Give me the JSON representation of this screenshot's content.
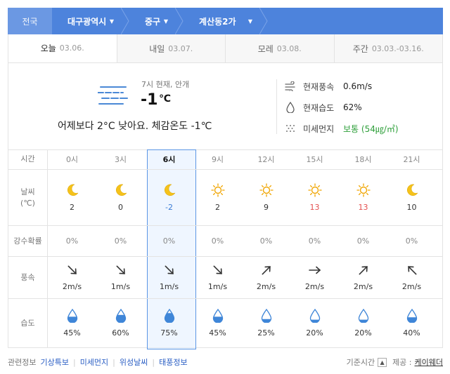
{
  "breadcrumb": {
    "root": "전국",
    "city": "대구광역시",
    "district": "중구",
    "dong": "계산동2가"
  },
  "tabs": [
    {
      "label": "오늘",
      "date": "03.06."
    },
    {
      "label": "내일",
      "date": "03.07."
    },
    {
      "label": "모레",
      "date": "03.08."
    },
    {
      "label": "주간",
      "date": "03.03.-03.16."
    }
  ],
  "current": {
    "status": "7시 현재, 안개",
    "temp": "-1",
    "unit": "℃",
    "compare": "어제보다 2°C 낮아요.   체감온도 -1℃",
    "icon": "fog-icon",
    "wind_label": "현재풍속",
    "wind_value": "0.6m/s",
    "humidity_label": "현재습도",
    "humidity_value": "62%",
    "dust_label": "미세먼지",
    "dust_value": "보통 (54㎍/㎥)"
  },
  "table": {
    "row_labels": {
      "time": "시간",
      "weather": "날씨\n(℃)",
      "precip": "강수확률",
      "wind": "풍속",
      "humidity": "습도"
    },
    "hours": [
      "0시",
      "3시",
      "6시",
      "9시",
      "12시",
      "15시",
      "18시",
      "21시"
    ],
    "current_index": 2,
    "weather": [
      "moon",
      "moon",
      "moon",
      "sun",
      "sun",
      "sun",
      "sun",
      "moon"
    ],
    "temps": [
      "2",
      "0",
      "-2",
      "2",
      "9",
      "13",
      "13",
      "10"
    ],
    "precip": [
      "0%",
      "0%",
      "0%",
      "0%",
      "0%",
      "0%",
      "0%",
      "0%"
    ],
    "wind_dir": [
      "arrow-down-right",
      "arrow-down-right",
      "arrow-down-right",
      "arrow-down-right",
      "arrow-up-right",
      "arrow-right",
      "arrow-up-right",
      "arrow-up-left"
    ],
    "wind_speed": [
      "2m/s",
      "1m/s",
      "1m/s",
      "1m/s",
      "2m/s",
      "2m/s",
      "2m/s",
      "2m/s"
    ],
    "humidity": [
      "45%",
      "60%",
      "75%",
      "45%",
      "25%",
      "20%",
      "20%",
      "40%"
    ],
    "humidity_fill": [
      0.45,
      0.6,
      0.75,
      0.45,
      0.25,
      0.2,
      0.2,
      0.4
    ]
  },
  "colors": {
    "accent": "#4d83dc",
    "hot": "#e45050",
    "current": "#3a7bd5",
    "good": "#2e9f3a"
  },
  "footer": {
    "related": "관련정보",
    "links": [
      "기상특보",
      "미세먼지",
      "위성날씨",
      "태풍정보"
    ],
    "basetime": "기준시간",
    "provider_label": "제공 :",
    "provider": "케이웨더"
  }
}
